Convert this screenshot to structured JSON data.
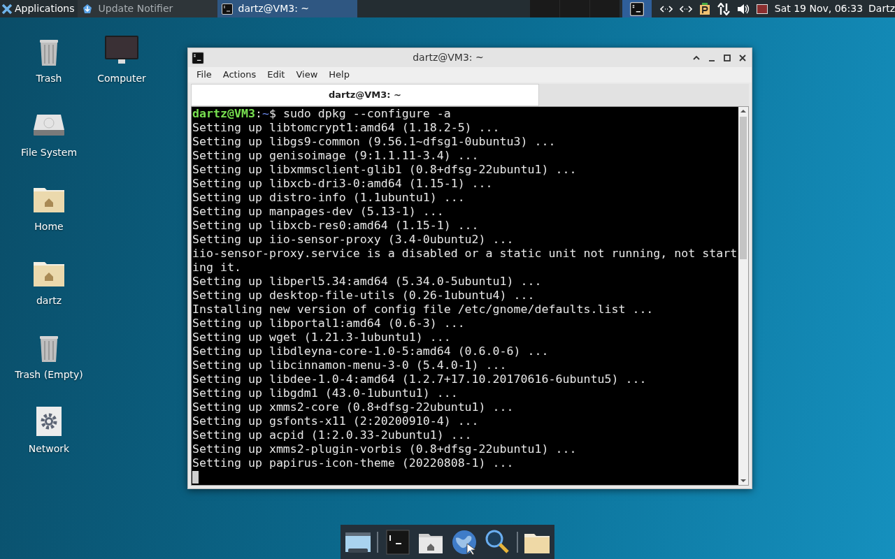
{
  "panel": {
    "applications": "Applications",
    "tasks": [
      {
        "title": "Update Notifier",
        "kind": "notifier",
        "selected": false
      },
      {
        "title": "dartz@VM3: ~",
        "kind": "terminal",
        "selected": true
      }
    ],
    "clock": "Sat 19 Nov, 06:33",
    "user": "Dartz"
  },
  "desktop_icons": [
    {
      "label": "Trash",
      "kind": "trash"
    },
    {
      "label": "Computer",
      "kind": "computer"
    },
    {
      "label": "File System",
      "kind": "drive"
    },
    {
      "label": "Home",
      "kind": "home"
    },
    {
      "label": "dartz",
      "kind": "home"
    },
    {
      "label": "Trash (Empty)",
      "kind": "trash"
    },
    {
      "label": "Network",
      "kind": "network"
    }
  ],
  "window": {
    "title": "dartz@VM3: ~",
    "menu": [
      "File",
      "Actions",
      "Edit",
      "View",
      "Help"
    ],
    "tabs": [
      {
        "label": "dartz@VM3: ~",
        "selected": true
      }
    ],
    "terminal": {
      "prompt": {
        "user_host": "dartz@VM3",
        "separator": ":",
        "path": "~",
        "command": "$ sudo dpkg --configure -a"
      },
      "lines": [
        "Setting up libtomcrypt1:amd64 (1.18.2-5) ...",
        "Setting up libgs9-common (9.56.1~dfsg1-0ubuntu3) ...",
        "Setting up genisoimage (9:1.1.11-3.4) ...",
        "Setting up libxmmsclient-glib1 (0.8+dfsg-22ubuntu1) ...",
        "Setting up libxcb-dri3-0:amd64 (1.15-1) ...",
        "Setting up distro-info (1.1ubuntu1) ...",
        "Setting up manpages-dev (5.13-1) ...",
        "Setting up libxcb-res0:amd64 (1.15-1) ...",
        "Setting up iio-sensor-proxy (3.4-0ubuntu2) ...",
        "iio-sensor-proxy.service is a disabled or a static unit not running, not start",
        "ing it.",
        "Setting up libperl5.34:amd64 (5.34.0-5ubuntu1) ...",
        "Setting up desktop-file-utils (0.26-1ubuntu4) ...",
        "Installing new version of config file /etc/gnome/defaults.list ...",
        "Setting up libportal1:amd64 (0.6-3) ...",
        "Setting up wget (1.21.3-1ubuntu1) ...",
        "Setting up libdleyna-core-1.0-5:amd64 (0.6.0-6) ...",
        "Setting up libcinnamon-menu-3-0 (5.4.0-1) ...",
        "Setting up libdee-1.0-4:amd64 (1.2.7+17.10.20170616-6ubuntu5) ...",
        "Setting up libgdm1 (43.0-1ubuntu1) ...",
        "Setting up xmms2-core (0.8+dfsg-22ubuntu1) ...",
        "Setting up gsfonts-x11 (2:20200910-4) ...",
        "Setting up acpid (1:2.0.33-2ubuntu1) ...",
        "Setting up xmms2-plugin-vorbis (0.8+dfsg-22ubuntu1) ...",
        "Setting up papirus-icon-theme (20220808-1) ..."
      ]
    }
  },
  "dock": [
    {
      "kind": "windows"
    },
    {
      "kind": "terminal"
    },
    {
      "kind": "home"
    },
    {
      "kind": "globe"
    },
    {
      "kind": "search"
    },
    {
      "kind": "folder"
    }
  ]
}
